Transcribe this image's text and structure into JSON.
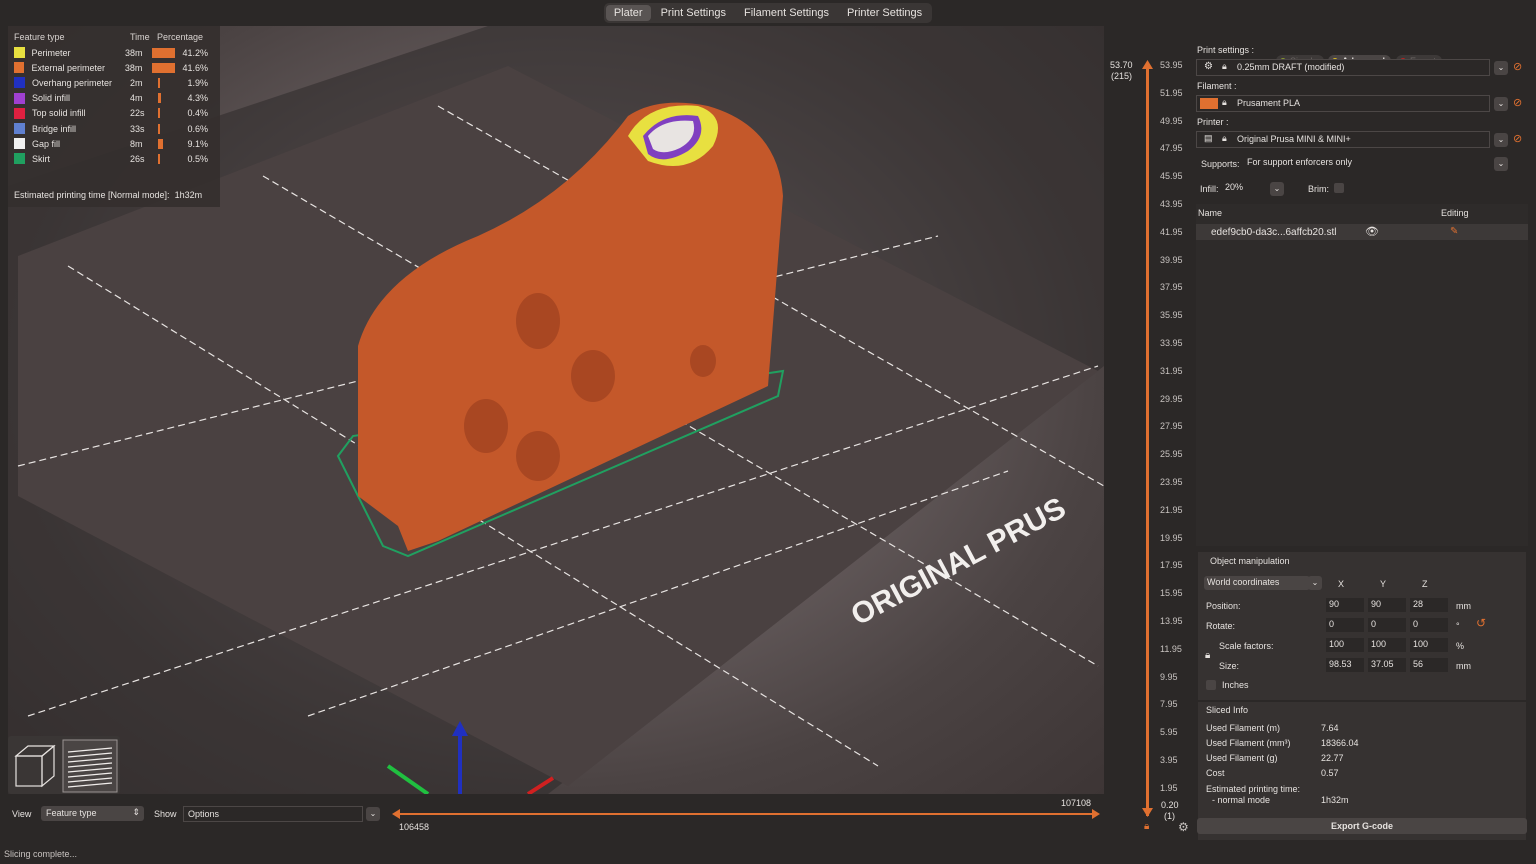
{
  "tabs": [
    "Plater",
    "Print Settings",
    "Filament Settings",
    "Printer Settings"
  ],
  "legend": {
    "headers": {
      "type": "Feature type",
      "time": "Time",
      "pct": "Percentage"
    },
    "rows": [
      {
        "name": "Perimeter",
        "time": "38m",
        "pct": "41.2%",
        "value": 41.2,
        "color": "#e8e040"
      },
      {
        "name": "External perimeter",
        "time": "38m",
        "pct": "41.6%",
        "value": 41.6,
        "color": "#e07030"
      },
      {
        "name": "Overhang perimeter",
        "time": "2m",
        "pct": "1.9%",
        "value": 1.9,
        "color": "#2030c0"
      },
      {
        "name": "Solid infill",
        "time": "4m",
        "pct": "4.3%",
        "value": 4.3,
        "color": "#a040d0"
      },
      {
        "name": "Top solid infill",
        "time": "22s",
        "pct": "0.4%",
        "value": 0.4,
        "color": "#e02040"
      },
      {
        "name": "Bridge infill",
        "time": "33s",
        "pct": "0.6%",
        "value": 0.6,
        "color": "#6080d0"
      },
      {
        "name": "Gap fill",
        "time": "8m",
        "pct": "9.1%",
        "value": 9.1,
        "color": "#f0f0f0"
      },
      {
        "name": "Skirt",
        "time": "26s",
        "pct": "0.5%",
        "value": 0.5,
        "color": "#20a060"
      }
    ],
    "estimate_label": "Estimated printing time [Normal mode]:",
    "estimate_value": "1h32m"
  },
  "bed_text": "ORIGINAL PRUS",
  "bottom": {
    "view_label": "View",
    "view_value": "Feature type",
    "show_label": "Show",
    "show_value": "Options",
    "move_right": "107108",
    "move_left": "106458"
  },
  "status": "Slicing complete...",
  "vslider": {
    "top_value": "53.70",
    "top_layer": "(215)",
    "bottom_value": "0.20",
    "bottom_layer": "(1)",
    "ticks": [
      "53.95",
      "51.95",
      "49.95",
      "47.95",
      "45.95",
      "43.95",
      "41.95",
      "39.95",
      "37.95",
      "35.95",
      "33.95",
      "31.95",
      "29.95",
      "27.95",
      "25.95",
      "23.95",
      "21.95",
      "19.95",
      "17.95",
      "15.95",
      "13.95",
      "11.95",
      "9.95",
      "7.95",
      "5.95",
      "3.95",
      "1.95"
    ]
  },
  "panel": {
    "modes": [
      "Simple",
      "Advanced",
      "Expert"
    ],
    "print_settings_label": "Print settings :",
    "print_settings_value": "0.25mm DRAFT (modified)",
    "filament_label": "Filament :",
    "filament_value": "Prusament PLA",
    "printer_label": "Printer :",
    "printer_value": "Original Prusa MINI & MINI+",
    "supports_label": "Supports:",
    "supports_value": "For support enforcers only",
    "infill_label": "Infill:",
    "infill_value": "20%",
    "brim_label": "Brim:",
    "list_name": "Name",
    "list_editing": "Editing",
    "object_name": "edef9cb0-da3c...6affcb20.stl",
    "om_title": "Object manipulation",
    "coords": "World coordinates",
    "x": "X",
    "y": "Y",
    "z": "Z",
    "position_label": "Position:",
    "position": [
      "90",
      "90",
      "28"
    ],
    "position_unit": "mm",
    "rotate_label": "Rotate:",
    "rotate": [
      "0",
      "0",
      "0"
    ],
    "rotate_unit": "°",
    "scale_label": "Scale factors:",
    "scale": [
      "100",
      "100",
      "100"
    ],
    "scale_unit": "%",
    "size_label": "Size:",
    "size": [
      "98.53",
      "37.05",
      "56"
    ],
    "size_unit": "mm",
    "inches_label": "Inches",
    "si_title": "Sliced Info",
    "si": [
      {
        "k": "Used Filament (m)",
        "v": "7.64"
      },
      {
        "k": "Used Filament (mm³)",
        "v": "18366.04"
      },
      {
        "k": "Used Filament (g)",
        "v": "22.77"
      },
      {
        "k": "Cost",
        "v": "0.57"
      }
    ],
    "si_time_label": "Estimated printing time:",
    "si_mode_label": "- normal mode",
    "si_time": "1h32m",
    "export_label": "Export G-code"
  }
}
